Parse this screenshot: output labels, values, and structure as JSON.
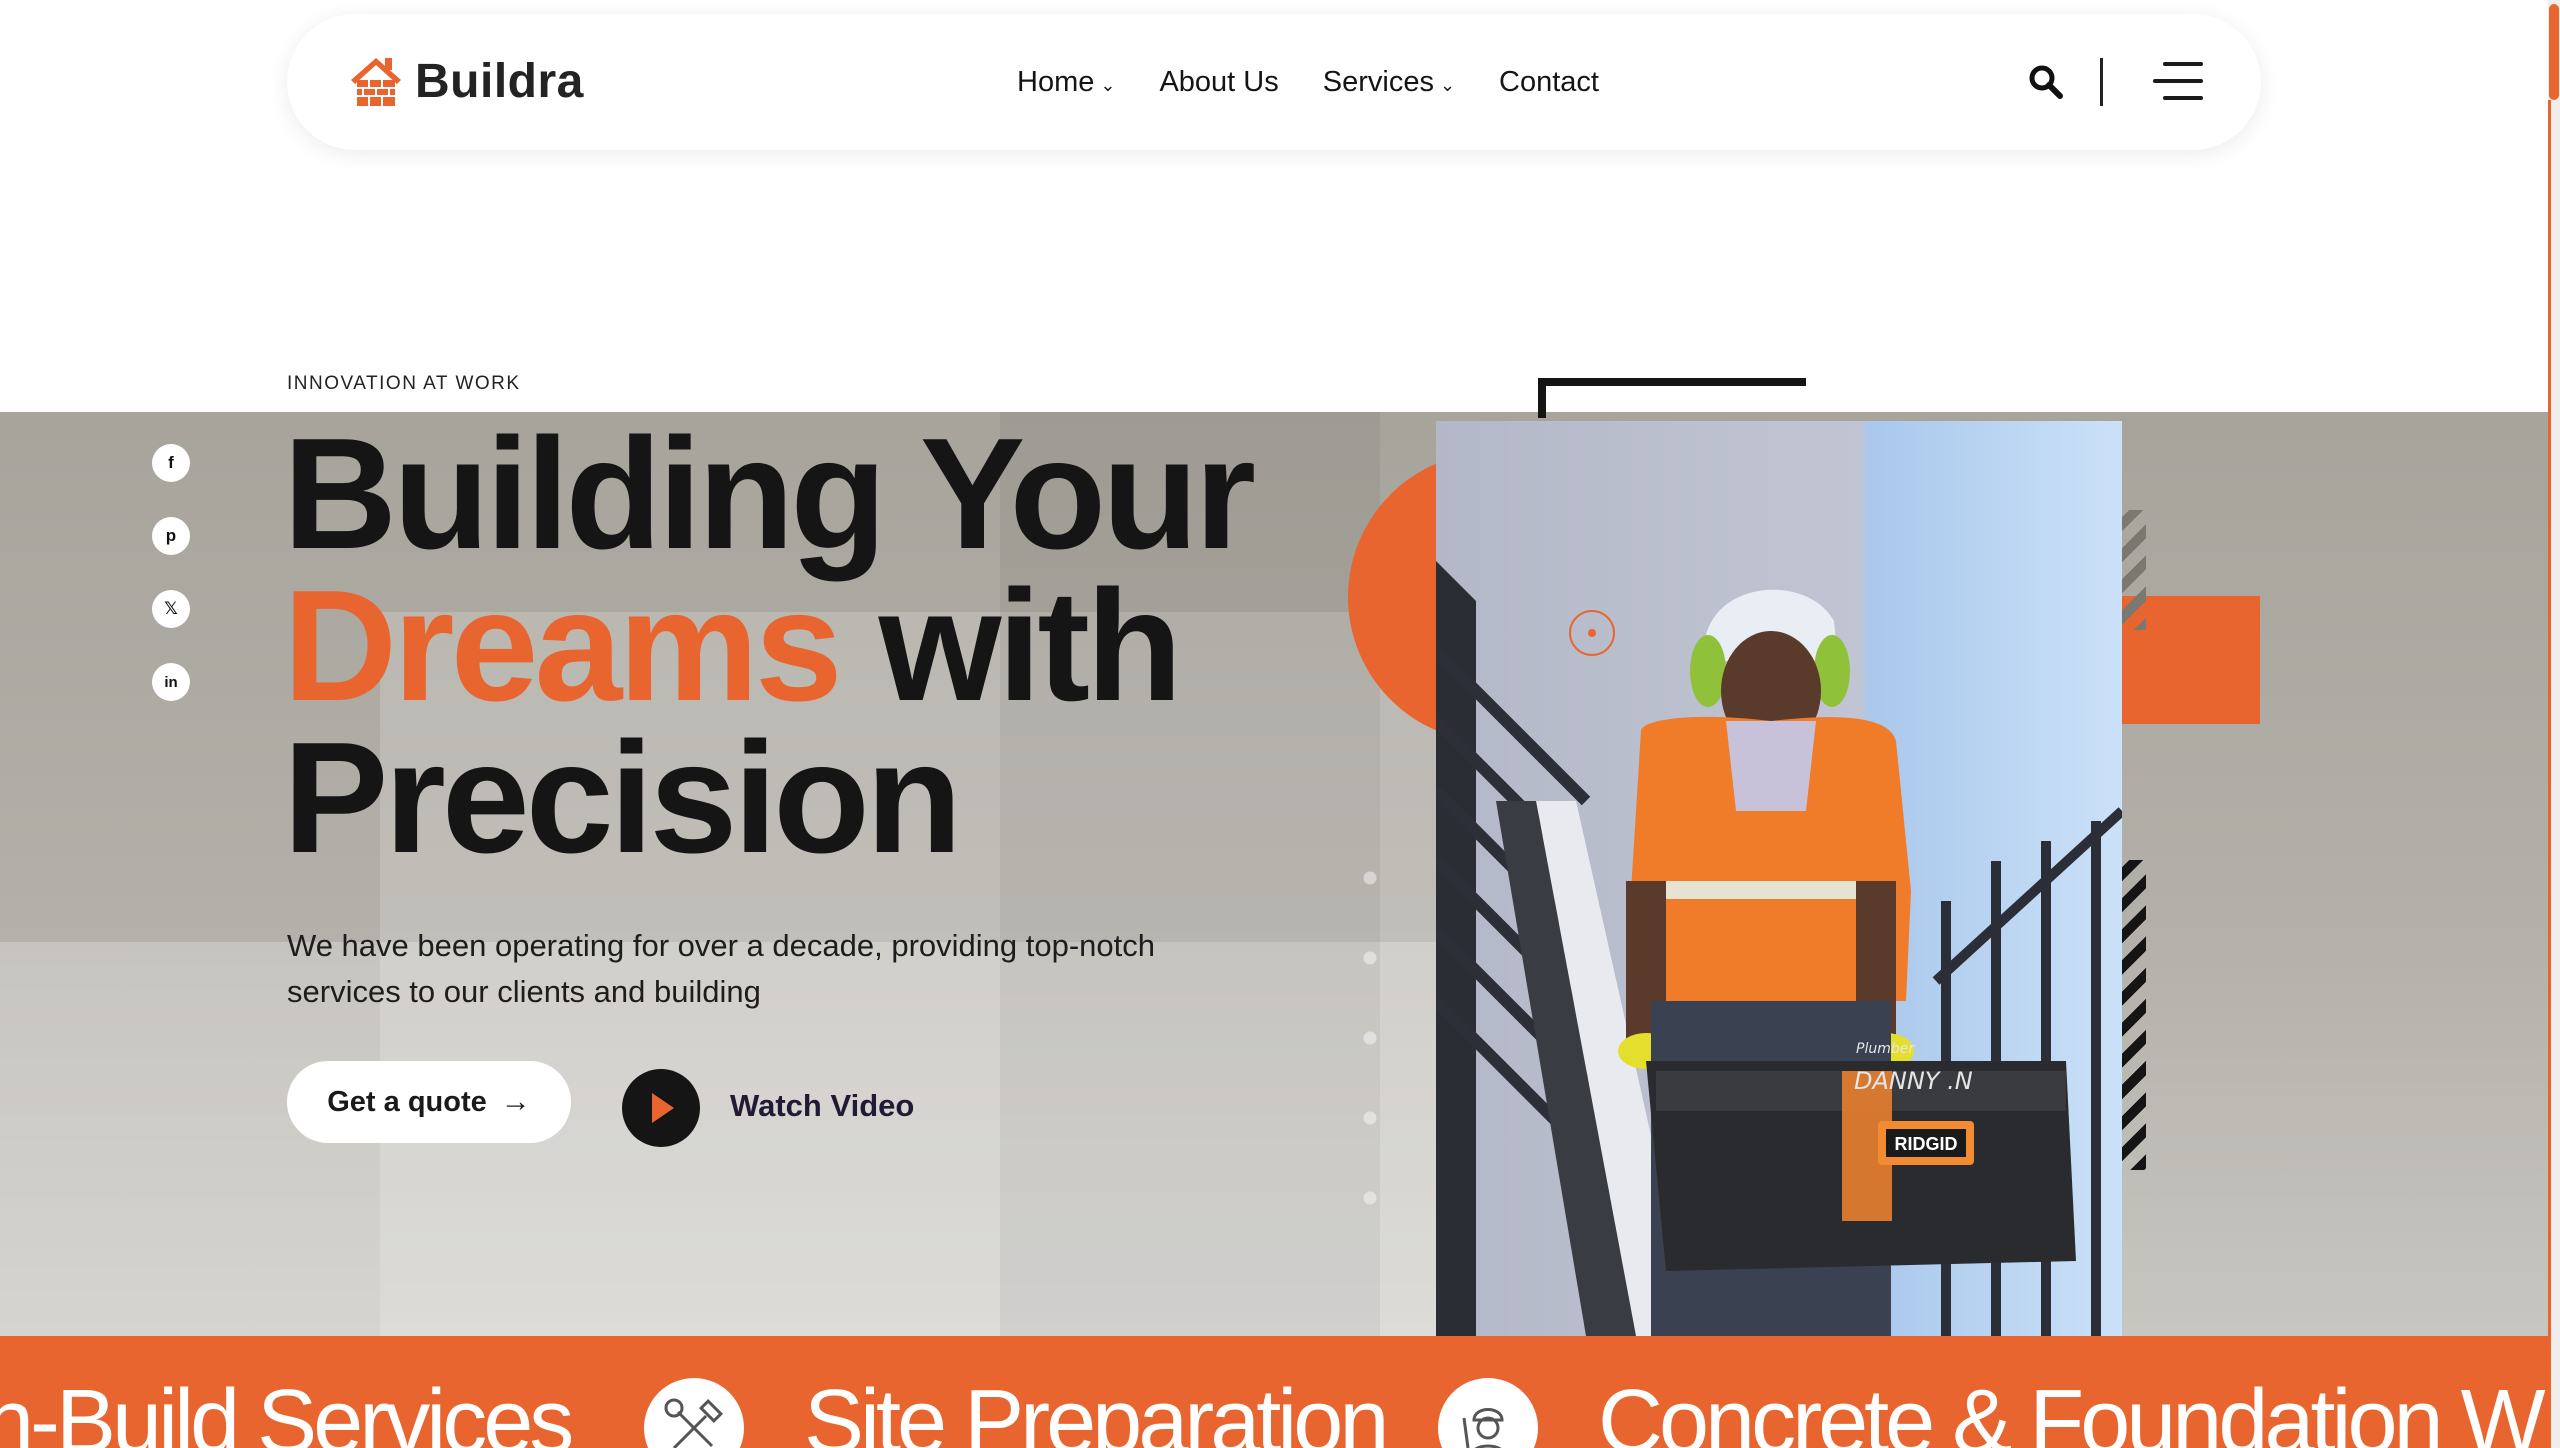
{
  "brand": {
    "name": "Buildra",
    "accent": "#e8652f",
    "dark": "#151515"
  },
  "nav": {
    "items": [
      {
        "label": "Home",
        "has_dropdown": true
      },
      {
        "label": "About Us",
        "has_dropdown": false
      },
      {
        "label": "Services",
        "has_dropdown": true
      },
      {
        "label": "Contact",
        "has_dropdown": false
      }
    ],
    "icons": [
      "search-icon",
      "hamburger-menu-icon"
    ]
  },
  "hero": {
    "eyebrow": "INNOVATION AT WORK",
    "title_line1": "Building Your",
    "title_accent": "Dreams",
    "title_line2_rest": "with",
    "title_line3": "Precision",
    "description": "We have been operating for over a decade, providing top-notch services to our clients and building",
    "quote_label": "Get a quote",
    "watch_label": "Watch Video"
  },
  "social": [
    {
      "name": "facebook",
      "glyph": "f"
    },
    {
      "name": "pinterest",
      "glyph": "p"
    },
    {
      "name": "x",
      "glyph": "𝕏"
    },
    {
      "name": "linkedin",
      "glyph": "in"
    }
  ],
  "photo": {
    "toolbox_brand": "RIDGID",
    "toolbox_marker_line1": "Plumber",
    "toolbox_marker_line2": "DANNY .N"
  },
  "ticker": {
    "items": [
      "n-Build Services",
      "Site Preparation",
      "Concrete & Foundation W"
    ],
    "icons": [
      "hammer-wrench-icon",
      "construction-worker-icon"
    ]
  }
}
